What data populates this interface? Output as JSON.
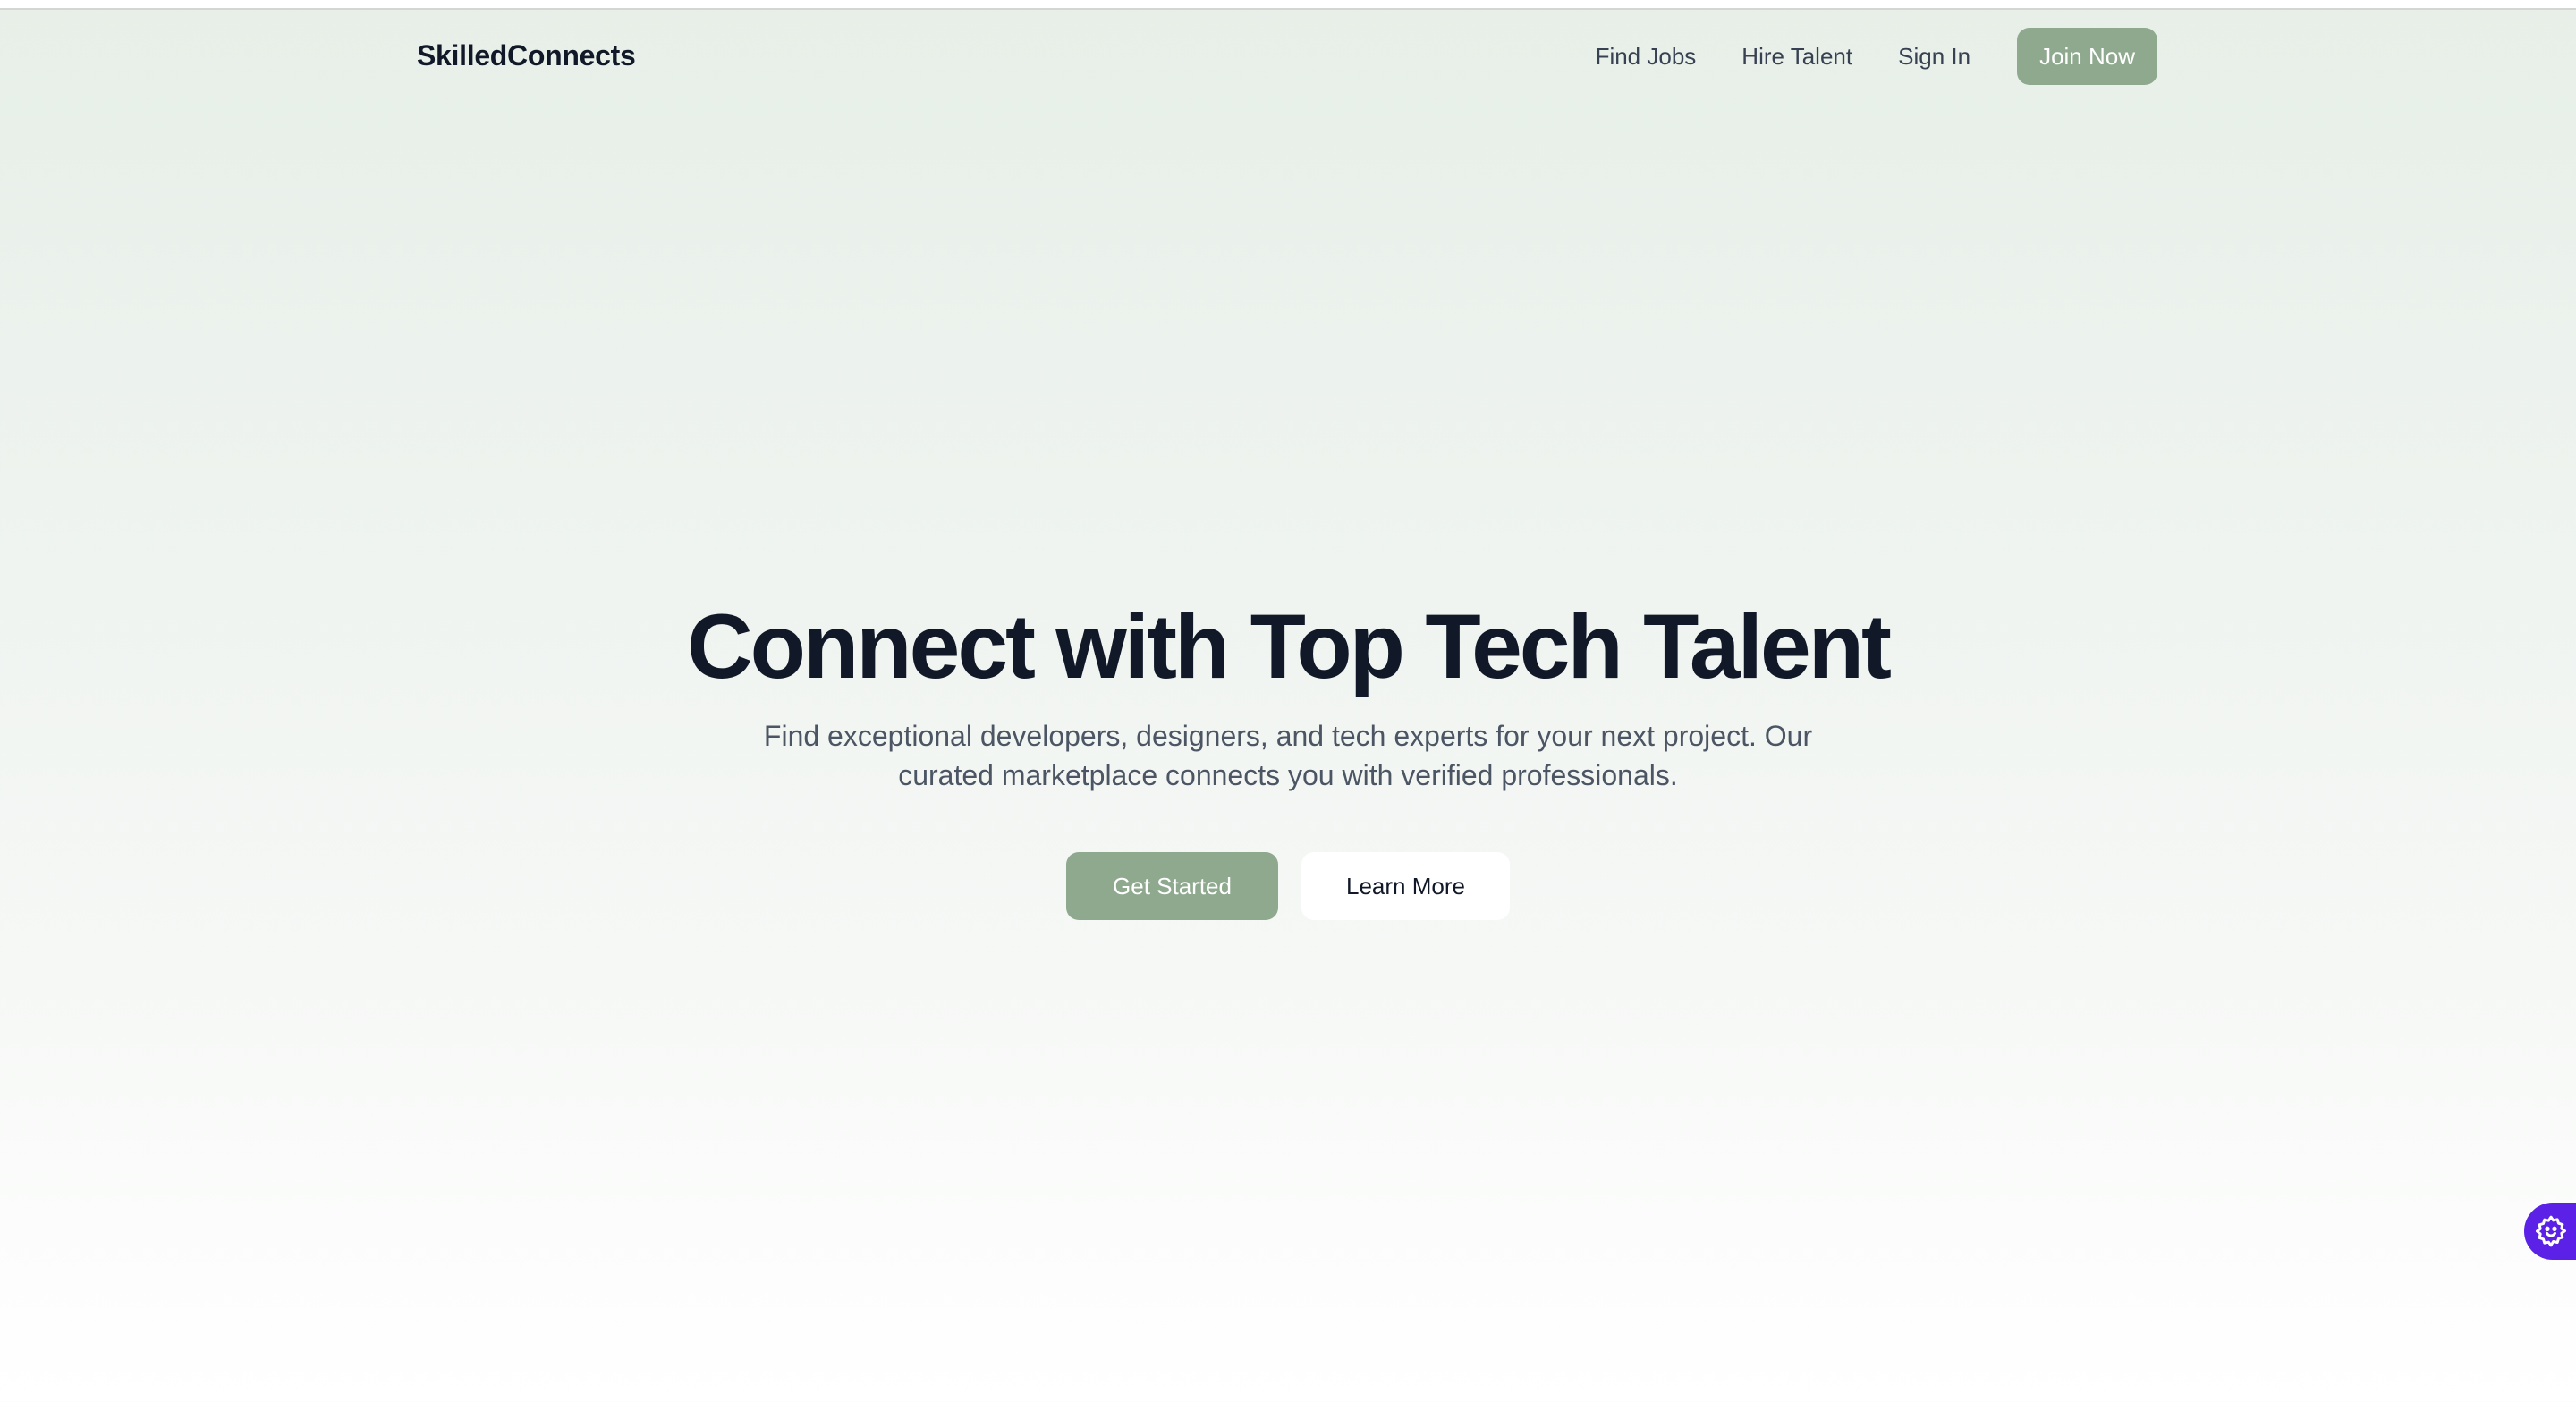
{
  "header": {
    "brand": "SkilledConnects",
    "nav": [
      "Find Jobs",
      "Hire Talent",
      "Sign In"
    ],
    "cta": "Join Now"
  },
  "hero": {
    "title": "Connect with Top Tech Talent",
    "subtitle_line1": "Find exceptional developers, designers, and tech experts for your next project. Our",
    "subtitle_line2": "curated marketplace connects you with verified professionals.",
    "primary_button": "Get Started",
    "secondary_button": "Learn More"
  },
  "widget": {
    "icon": "gear-icon"
  },
  "colors": {
    "accent": "#8fa98f",
    "heading": "#111827",
    "body_text": "#4b5563",
    "widget": "#5b21e6"
  }
}
